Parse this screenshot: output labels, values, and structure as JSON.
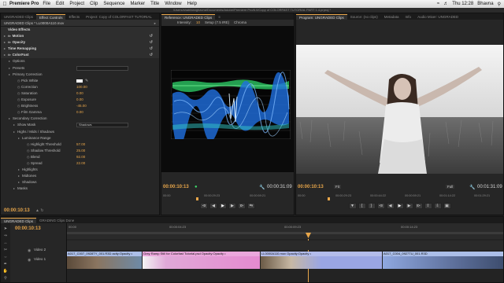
{
  "menubar": {
    "app_name": "Premiere Pro",
    "items": [
      "File",
      "Edit",
      "Project",
      "Clip",
      "Sequence",
      "Marker",
      "Title",
      "Window",
      "Help"
    ],
    "clock": "Thu 12:28",
    "user": "Bhavna"
  },
  "window": {
    "title": "/Users/shabbianghavna/Documents/Adobe/Premiere Pro/6.0/Copy of COLORFAST TUTORIAL PART 1.4.prproj *"
  },
  "effect_controls": {
    "tabs": [
      "UNGRADED Clips",
      "Effect Controls",
      "Effects",
      "Project: Copy of COLORFAST TUTORIAL"
    ],
    "active_tab": "Effect Controls",
    "clip_name": "UNGRADED Clips * LL0000A110.mov",
    "rows": [
      {
        "label": "Video Effects",
        "kind": "header"
      },
      {
        "label": "Motion",
        "kind": "section",
        "fx": "fx"
      },
      {
        "label": "Opacity",
        "kind": "section",
        "fx": "fx"
      },
      {
        "label": "Time Remapping",
        "kind": "section"
      },
      {
        "label": "ColorFast",
        "kind": "section",
        "fx": "fx"
      },
      {
        "label": "Options",
        "indent": 1
      },
      {
        "label": "Presets",
        "indent": 1,
        "dropdown": ""
      },
      {
        "label": "Primary Correction",
        "indent": 1
      },
      {
        "label": "Pick White",
        "indent": 2,
        "swatch": true
      },
      {
        "label": "Correction",
        "indent": 2,
        "value": "100.00"
      },
      {
        "label": "Saturation",
        "indent": 2,
        "value": "0.00"
      },
      {
        "label": "Exposure",
        "indent": 2,
        "value": "0.00"
      },
      {
        "label": "Brightness",
        "indent": 2,
        "value": "-45.00"
      },
      {
        "label": "Film Gamma",
        "indent": 2,
        "value": "0.00"
      },
      {
        "label": "Secondary Correction",
        "indent": 1
      },
      {
        "label": "Show Mask",
        "indent": 2,
        "dropdown": "Shadows"
      },
      {
        "label": "Highs / Mids / Shadows",
        "indent": 2
      },
      {
        "label": "Luminance Range",
        "indent": 3
      },
      {
        "label": "Highlight Threshold",
        "indent": 4,
        "value": "57.00"
      },
      {
        "label": "Shadow Threshold",
        "indent": 4,
        "value": "25.00"
      },
      {
        "label": "Blend",
        "indent": 4,
        "value": "92.00"
      },
      {
        "label": "Spread",
        "indent": 4,
        "value": "22.00"
      },
      {
        "label": "Highlights",
        "indent": 3
      },
      {
        "label": "Midtones",
        "indent": 3
      },
      {
        "label": "Shadows",
        "indent": 3
      },
      {
        "label": "Masks",
        "indent": 2
      }
    ],
    "timecode": "00:00:10:13"
  },
  "reference_monitor": {
    "tab": "Reference: UNGRADED Clips",
    "intensity_label": "Intensity:",
    "intensity_value": "10",
    "setup_label": "Setup (7.5 IRE)",
    "chroma_label": "Chroma",
    "timecode_left": "00:00:10:13",
    "timecode_right": "00:00:31:09",
    "ruler_ticks": [
      "00:00",
      "00:00:29:23",
      "00:00:59:21"
    ]
  },
  "program_monitor": {
    "tabs": [
      "Program: UNGRADED Clips",
      "Source: (no clips)",
      "Metadata",
      "Info",
      "Audio Mixer: UNGRADED"
    ],
    "active_tab": "Program: UNGRADED Clips",
    "timecode_left": "00:00:10:13",
    "fit": "Fit",
    "quality": "Full",
    "timecode_right": "00:01:31:09",
    "ruler_ticks": [
      "00:00",
      "00:00:29:23",
      "00:00:44:22",
      "00:00:59:21",
      "00:01:14:22",
      "00:01:29:21"
    ]
  },
  "timeline": {
    "tabs": [
      "UNGRADED Clips",
      "GRADING Clips Done"
    ],
    "active_tab": "UNGRADED Clips",
    "timecode": "00:00:10:13",
    "ruler_ticks": [
      "00:00",
      "00:00:04:23",
      "00:00:09:23",
      "00:00:14:23"
    ],
    "tracks": {
      "video2": "Video 2",
      "video1": "Video 1"
    },
    "clips": [
      {
        "label": "A017_C007_0928TY_001.R3D  acity:Opacity •",
        "color": "#8fa8e0"
      },
      {
        "label": "Grey Ramp Still for Colorfast Tutorial.psd  Opacity:Opacity •",
        "color": "#e58ad0"
      },
      {
        "label": "LL0000A110.mov  Opacity:Opacity •",
        "color": "#9aa6e4"
      },
      {
        "label": "A017_C004_0927TU_001.R3D",
        "color": "#8fa8e0"
      }
    ]
  },
  "colors": {
    "accent": "#e8a64a",
    "panel": "#262626",
    "clip_blue": "#8fa8e0",
    "clip_pink": "#e58ad0"
  }
}
